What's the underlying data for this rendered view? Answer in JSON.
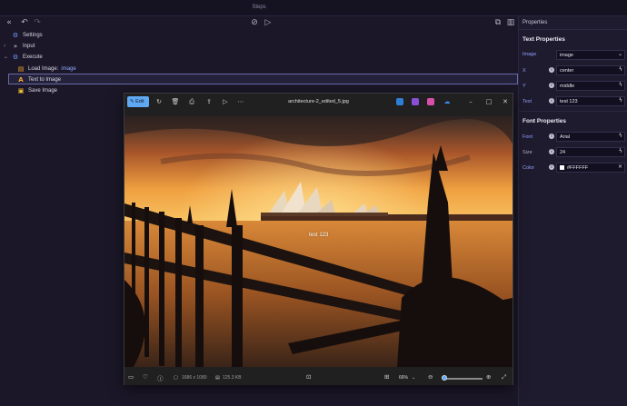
{
  "window": {
    "title": "Steps"
  },
  "toolbar": {
    "collapse_icon": "«",
    "undo_icon": "↶",
    "redo_icon": "↷",
    "stop_icon": "⊘",
    "run_icon": "▷",
    "export_icon": "⧉",
    "panel_icon": "▥"
  },
  "tree": {
    "settings": "Settings",
    "input": "Input",
    "execute": "Execute",
    "steps": [
      {
        "label": "Load Image:",
        "value": "image"
      },
      {
        "label": "Text to Image",
        "value": ""
      },
      {
        "label": "Save Image",
        "value": ""
      }
    ]
  },
  "properties": {
    "header": "Properties",
    "text_section": "Text Properties",
    "font_section": "Font Properties",
    "fields": {
      "image": {
        "label": "Image",
        "value": "image"
      },
      "x": {
        "label": "X",
        "value": "center"
      },
      "y": {
        "label": "Y",
        "value": "middle"
      },
      "text": {
        "label": "Text",
        "value": "test 123"
      },
      "font": {
        "label": "Font",
        "value": "Arial"
      },
      "size": {
        "label": "Size",
        "value": "24"
      },
      "color": {
        "label": "Color",
        "value": "#FFFFFF"
      }
    }
  },
  "viewer": {
    "edit_label": "Edit",
    "filename": "architecture-2_edited_5.jpg",
    "overlay_text": "test 123",
    "dimensions": "1686 x 1080",
    "file_size": "125.3 KB",
    "zoom": "66%",
    "zoom_level": 0.05
  },
  "colors": {
    "accent": "#8ea1ff",
    "edit_button": "#5fa8f2",
    "panel_bg": "#1b1728"
  }
}
